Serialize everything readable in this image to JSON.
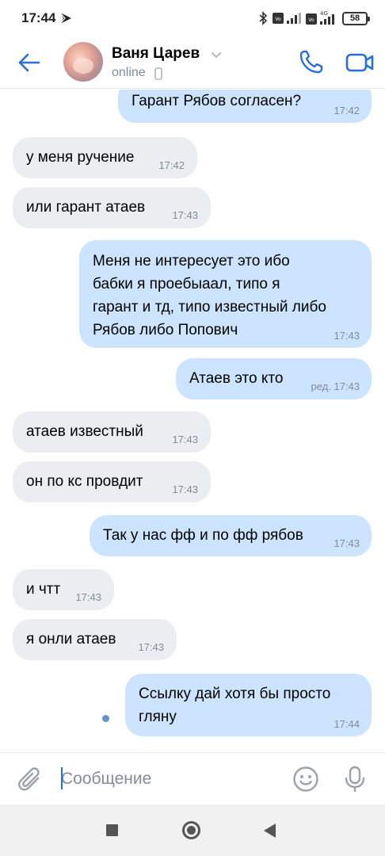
{
  "status_bar": {
    "time": "17:44",
    "network": "4G",
    "battery": "58"
  },
  "header": {
    "contact_name": "Ваня Царев",
    "contact_status": "online",
    "accent_color": "#2a6fd6"
  },
  "messages": [
    {
      "direction": "out",
      "text": "Гарант Рябов согласен?",
      "time": "17:42"
    },
    {
      "direction": "in",
      "text": "у меня ручение",
      "time": "17:42"
    },
    {
      "direction": "in",
      "text": "или гарант атаев",
      "time": "17:43"
    },
    {
      "direction": "out",
      "text": "Меня не интересует это ибо\nбабки я проебыаал, типо я\nгарант и тд, типо известный либо\nРябов либо Попович",
      "time": "17:43"
    },
    {
      "direction": "out",
      "text": "Атаев это кто",
      "time": "ред. 17:43"
    },
    {
      "direction": "in",
      "text": "атаев известный",
      "time": "17:43"
    },
    {
      "direction": "in",
      "text": "он по кс провдит",
      "time": "17:43"
    },
    {
      "direction": "out",
      "text": "Так у нас фф и по фф рябов",
      "time": "17:43"
    },
    {
      "direction": "in",
      "text": "и чтт",
      "time": "17:43"
    },
    {
      "direction": "in",
      "text": "я онли атаев",
      "time": "17:43"
    },
    {
      "direction": "out",
      "text": "Ссылку дай хотя бы просто\nгляну",
      "time": "17:44"
    }
  ],
  "composer": {
    "placeholder": "Сообщение"
  },
  "colors": {
    "incoming_bubble": "#ebedf0",
    "outgoing_bubble": "#cce4ff",
    "timestamp": "#818c99"
  }
}
